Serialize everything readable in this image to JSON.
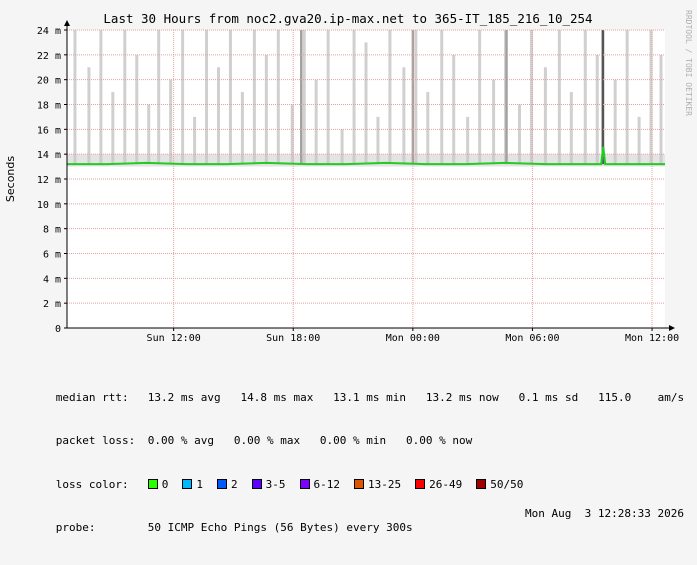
{
  "colors": {
    "background": "#f5f5f5",
    "plot_background": "#ffffff",
    "grid": "#e6a0a0",
    "axis": "#000000",
    "rtt_line": "#22cc22",
    "smoke": "#c8c8c8",
    "side_text": "#b0b0b0"
  },
  "chart_data": {
    "type": "line",
    "title": "Last 30 Hours from noc2.gva20.ip-max.net to 365-IT_185_216_10_254",
    "ylabel": "Seconds",
    "xlabel": "",
    "ylim": [
      0,
      24
    ],
    "xlim": [
      0,
      30
    ],
    "y_ticks": [
      {
        "v": 0,
        "label": "0"
      },
      {
        "v": 2,
        "label": "2 m"
      },
      {
        "v": 4,
        "label": "4 m"
      },
      {
        "v": 6,
        "label": "6 m"
      },
      {
        "v": 8,
        "label": "8 m"
      },
      {
        "v": 10,
        "label": "10 m"
      },
      {
        "v": 12,
        "label": "12 m"
      },
      {
        "v": 14,
        "label": "14 m"
      },
      {
        "v": 16,
        "label": "16 m"
      },
      {
        "v": 18,
        "label": "18 m"
      },
      {
        "v": 20,
        "label": "20 m"
      },
      {
        "v": 22,
        "label": "22 m"
      },
      {
        "v": 24,
        "label": "24 m"
      }
    ],
    "x_ticks": [
      {
        "v": 5.35,
        "label": "Sun 12:00"
      },
      {
        "v": 11.35,
        "label": "Sun 18:00"
      },
      {
        "v": 17.35,
        "label": "Mon 00:00"
      },
      {
        "v": 23.35,
        "label": "Mon 06:00"
      },
      {
        "v": 29.35,
        "label": "Mon 12:00"
      }
    ],
    "grid": true,
    "series": [
      {
        "median_rtt": [
          [
            0,
            13.2
          ],
          [
            2,
            13.2
          ],
          [
            4,
            13.3
          ],
          [
            6,
            13.2
          ],
          [
            8,
            13.2
          ],
          [
            10,
            13.3
          ],
          [
            12,
            13.2
          ],
          [
            14,
            13.2
          ],
          [
            16,
            13.3
          ],
          [
            18,
            13.2
          ],
          [
            20,
            13.2
          ],
          [
            22,
            13.3
          ],
          [
            24,
            13.2
          ],
          [
            26.8,
            13.2
          ],
          [
            26.9,
            14.6
          ],
          [
            27.0,
            13.2
          ],
          [
            28,
            13.2
          ],
          [
            30,
            13.2
          ]
        ]
      }
    ],
    "smoke_spikes": [
      [
        0.4,
        24
      ],
      [
        1.1,
        21
      ],
      [
        1.7,
        24
      ],
      [
        2.3,
        19
      ],
      [
        2.9,
        24
      ],
      [
        3.5,
        22
      ],
      [
        4.1,
        18
      ],
      [
        4.6,
        24
      ],
      [
        5.2,
        20
      ],
      [
        5.8,
        24
      ],
      [
        6.4,
        17
      ],
      [
        7.0,
        24
      ],
      [
        7.6,
        21
      ],
      [
        8.2,
        24
      ],
      [
        8.8,
        19
      ],
      [
        9.4,
        24
      ],
      [
        10.0,
        22
      ],
      [
        10.6,
        24
      ],
      [
        11.3,
        18
      ],
      [
        11.9,
        24
      ],
      [
        12.5,
        20
      ],
      [
        13.1,
        24
      ],
      [
        13.8,
        16
      ],
      [
        14.4,
        24
      ],
      [
        15.0,
        23
      ],
      [
        15.6,
        17
      ],
      [
        16.2,
        24
      ],
      [
        16.9,
        21
      ],
      [
        17.5,
        24
      ],
      [
        18.1,
        19
      ],
      [
        18.8,
        24
      ],
      [
        19.4,
        22
      ],
      [
        20.1,
        17
      ],
      [
        20.7,
        24
      ],
      [
        21.4,
        20
      ],
      [
        22.0,
        24
      ],
      [
        22.7,
        18
      ],
      [
        23.3,
        24
      ],
      [
        24.0,
        21
      ],
      [
        24.7,
        24
      ],
      [
        25.3,
        19
      ],
      [
        26.0,
        24
      ],
      [
        26.6,
        22
      ],
      [
        26.9,
        24
      ],
      [
        27.5,
        20
      ],
      [
        28.1,
        24
      ],
      [
        28.7,
        17
      ],
      [
        29.3,
        24
      ],
      [
        29.8,
        22
      ]
    ],
    "dark_spikes": [
      [
        11.75,
        24
      ],
      [
        17.35,
        24
      ],
      [
        22.05,
        24
      ],
      [
        26.88,
        24
      ]
    ]
  },
  "side_label": "RRDTOOL / TOBI OETIKER",
  "legend": {
    "median_label": "median rtt:",
    "median_stats": "13.2 ms avg   14.8 ms max   13.1 ms min   13.2 ms now   0.1 ms sd   115.0    am/s",
    "loss_label": "packet loss:",
    "loss_stats": "0.00 % avg   0.00 % max   0.00 % min   0.00 % now",
    "color_label": "loss color:",
    "loss_colors": [
      {
        "label": "0",
        "color": "#26ff00"
      },
      {
        "label": "1",
        "color": "#00b8ff"
      },
      {
        "label": "2",
        "color": "#0059ff"
      },
      {
        "label": "3-5",
        "color": "#5e00ff"
      },
      {
        "label": "6-12",
        "color": "#7e00ff"
      },
      {
        "label": "13-25",
        "color": "#dd5500"
      },
      {
        "label": "26-49",
        "color": "#ff0000"
      },
      {
        "label": "50/50",
        "color": "#a00000"
      }
    ],
    "probe_label": "probe:",
    "probe_text": "50 ICMP Echo Pings (56 Bytes) every 300s",
    "date": "Mon Aug  3 12:28:33 2026"
  }
}
